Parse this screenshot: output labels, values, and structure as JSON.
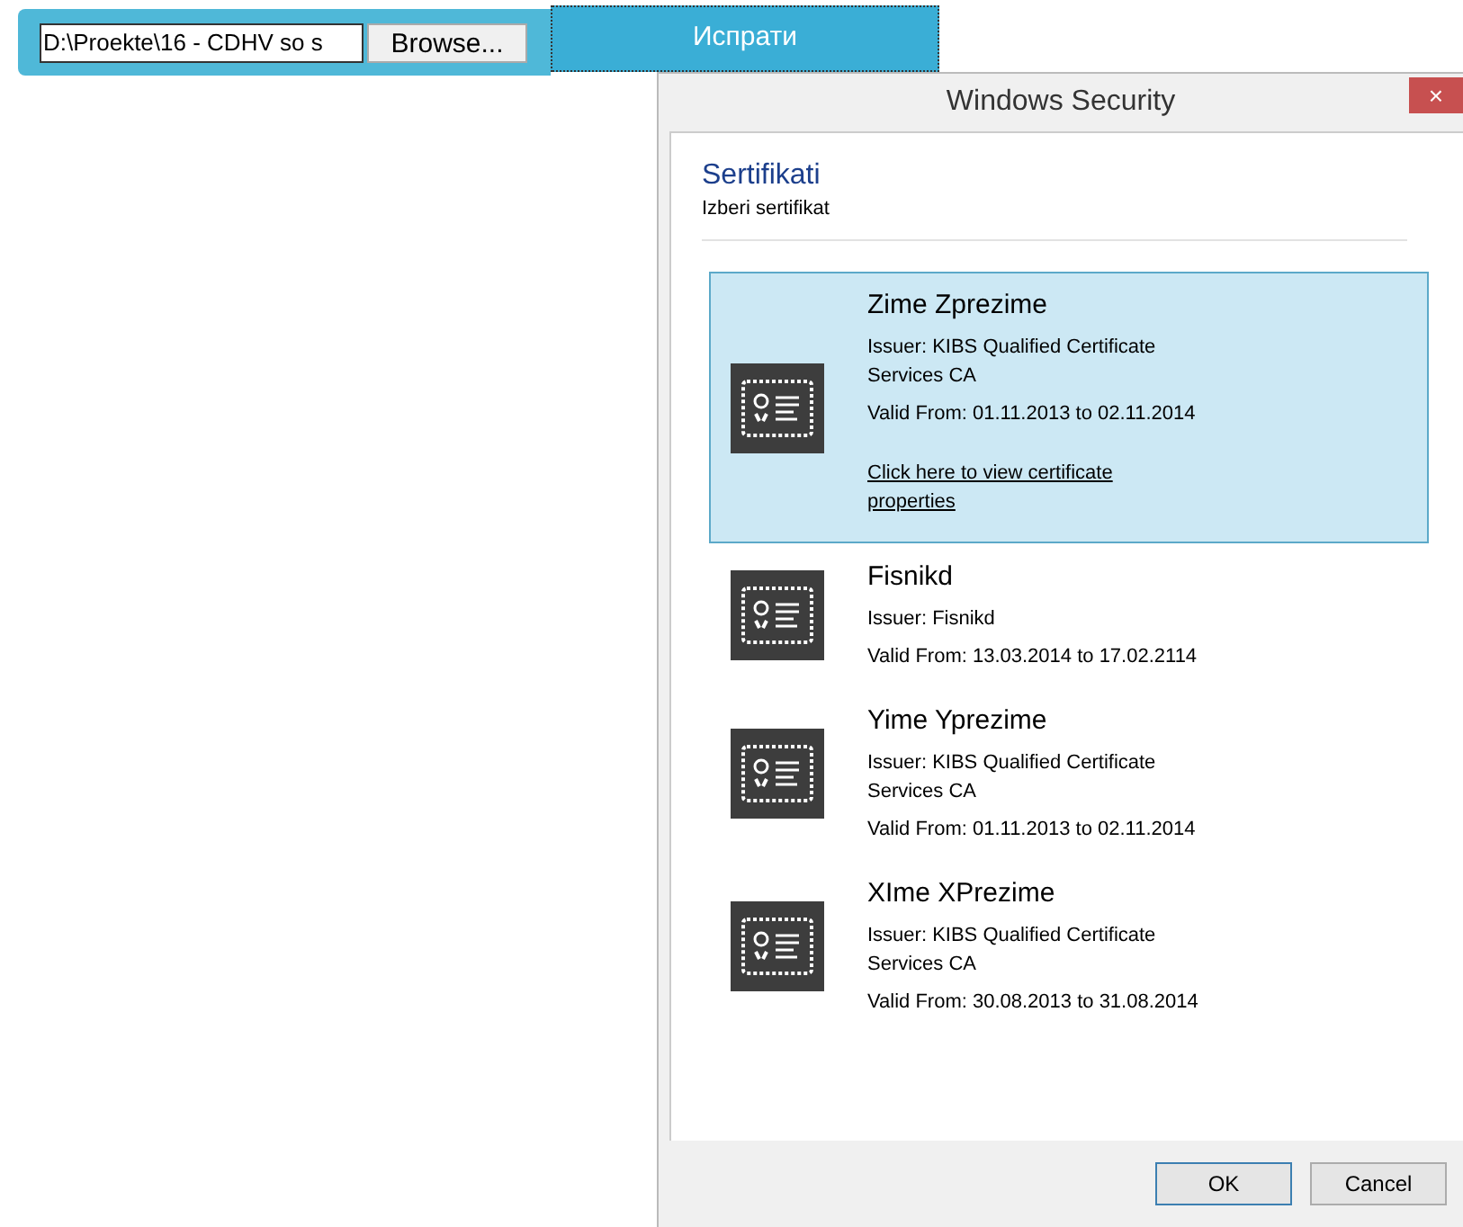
{
  "upload_form": {
    "file_path": "D:\\Proekte\\16 - CDHV so s",
    "browse_button": "Browse...",
    "send_button": "Испрати"
  },
  "dialog": {
    "title": "Windows Security",
    "close_button": "×",
    "heading": "Sertifikati",
    "subheading": "Izberi sertifikat",
    "certificates": [
      {
        "name": "Zime Zprezime",
        "issuer": "Issuer: KIBS Qualified Certificate Services CA",
        "valid": "Valid From: 01.11.2013 to 02.11.2014",
        "link": "Click here to view certificate properties",
        "selected": true
      },
      {
        "name": "Fisnikd",
        "issuer": "Issuer: Fisnikd",
        "valid": "Valid From: 13.03.2014 to 17.02.2114",
        "selected": false
      },
      {
        "name": "Yime Yprezime",
        "issuer": "Issuer: KIBS Qualified Certificate Services CA",
        "valid": "Valid From: 01.11.2013 to 02.11.2014",
        "selected": false
      },
      {
        "name": "XIme XPrezime",
        "issuer": "Issuer: KIBS Qualified Certificate Services CA",
        "valid": "Valid From: 30.08.2013 to 31.08.2014",
        "selected": false
      }
    ],
    "buttons": [
      "OK",
      "Cancel"
    ]
  }
}
